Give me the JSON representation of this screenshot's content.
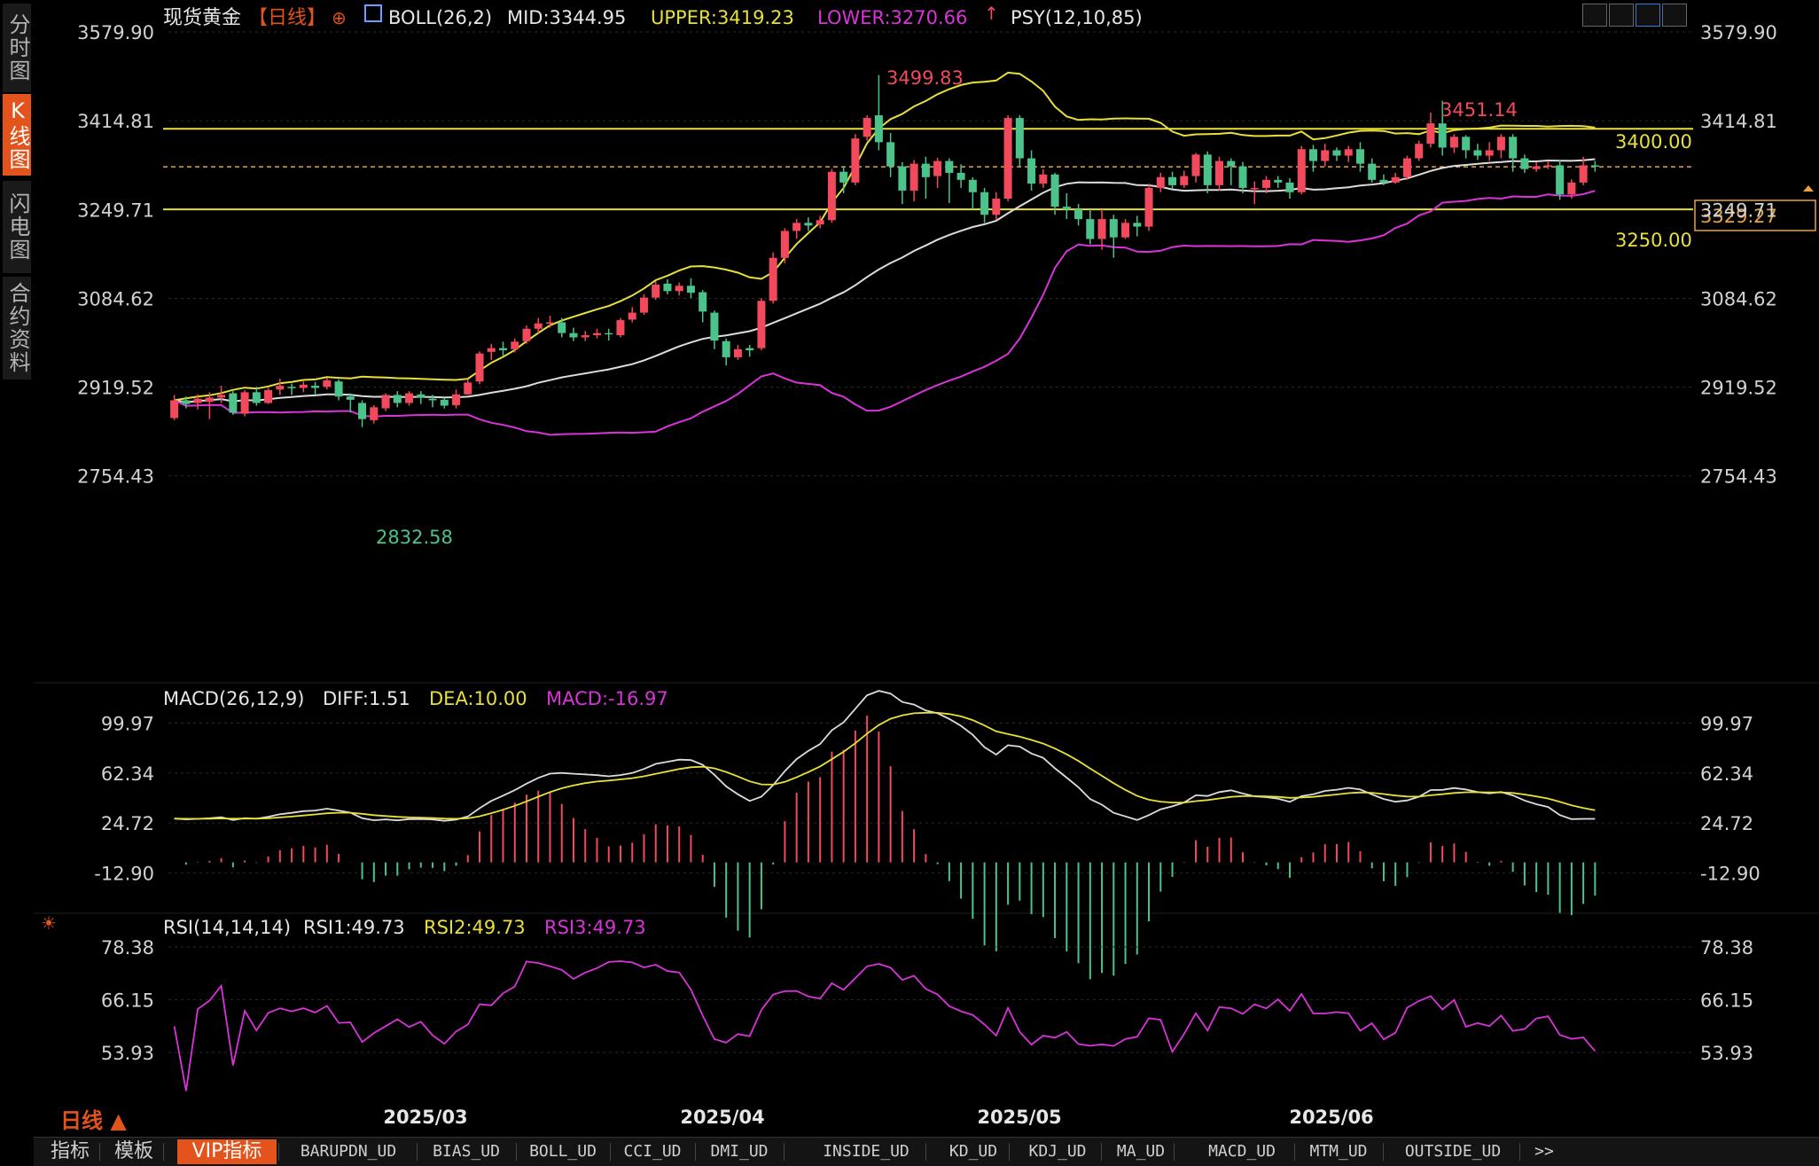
{
  "side_tabs": [
    {
      "label": "分时图",
      "active": false
    },
    {
      "label": "K线图",
      "active": true
    },
    {
      "label": "闪电图",
      "active": false
    },
    {
      "label": "合约资料",
      "active": false
    }
  ],
  "header": {
    "title": "现货黄金",
    "period": "【日线】",
    "boll_label": "BOLL(26,2)",
    "mid": "MID:3344.95",
    "upper": "UPPER:3419.23",
    "lower": "LOWER:3270.66",
    "psy": "PSY(12,10,85)"
  },
  "colors": {
    "up": "#f2495c",
    "down": "#4cc38a",
    "mid": "#dcdcdc",
    "upper": "#e8e03a",
    "lower": "#d933d9",
    "hline": "#e8e03a",
    "dashed": "#e8a23a",
    "accent": "#e2541b"
  },
  "price_axis": {
    "ticks": [
      "3579.90",
      "3414.81",
      "3249.71",
      "3084.62",
      "2919.52",
      "2754.43"
    ],
    "current_price": "3329.27"
  },
  "annotations": {
    "high1": "3499.83",
    "high2": "3451.14",
    "low1": "2832.58",
    "hline_upper": "3400.00",
    "hline_lower": "3250.00"
  },
  "macd": {
    "label": "MACD(26,12,9)",
    "diff": "DIFF:1.51",
    "dea": "DEA:10.00",
    "macd": "MACD:-16.97",
    "ticks": [
      "99.97",
      "62.34",
      "24.72",
      "-12.90"
    ]
  },
  "rsi": {
    "label": "RSI(14,14,14)",
    "rsi1": "RSI1:49.73",
    "rsi2": "RSI2:49.73",
    "rsi3": "RSI3:49.73",
    "ticks": [
      "78.38",
      "66.15",
      "53.93"
    ]
  },
  "x_axis": {
    "labels": [
      "2025/03",
      "2025/04",
      "2025/05",
      "2025/06"
    ],
    "period_button": "日线 ▲"
  },
  "bottom_tabs": [
    {
      "label": "指标",
      "active": false
    },
    {
      "label": "模板",
      "active": false
    },
    {
      "label": "VIP指标",
      "active": true
    },
    {
      "label": "BARUPDN_UD",
      "active": false
    },
    {
      "label": "BIAS_UD",
      "active": false
    },
    {
      "label": "BOLL_UD",
      "active": false
    },
    {
      "label": "CCI_UD",
      "active": false
    },
    {
      "label": "DMI_UD",
      "active": false
    },
    {
      "label": "INSIDE_UD",
      "active": false
    },
    {
      "label": "KD_UD",
      "active": false
    },
    {
      "label": "KDJ_UD",
      "active": false
    },
    {
      "label": "MA_UD",
      "active": false
    },
    {
      "label": "MACD_UD",
      "active": false
    },
    {
      "label": "MTM_UD",
      "active": false
    },
    {
      "label": "OUTSIDE_UD",
      "active": false
    },
    {
      "label": ">>",
      "active": false
    }
  ],
  "chart_data": {
    "type": "candlestick",
    "title": "现货黄金",
    "ylim": [
      2650,
      3590
    ],
    "candles": [
      [
        2862,
        2895,
        2858,
        2905
      ],
      [
        2895,
        2888,
        2880,
        2902
      ],
      [
        2890,
        2898,
        2878,
        2906
      ],
      [
        2892,
        2900,
        2860,
        2910
      ],
      [
        2900,
        2905,
        2890,
        2922
      ],
      [
        2908,
        2872,
        2868,
        2912
      ],
      [
        2870,
        2910,
        2865,
        2914
      ],
      [
        2910,
        2890,
        2885,
        2920
      ],
      [
        2890,
        2914,
        2888,
        2918
      ],
      [
        2915,
        2922,
        2905,
        2935
      ],
      [
        2920,
        2918,
        2905,
        2926
      ],
      [
        2918,
        2924,
        2910,
        2930
      ],
      [
        2922,
        2918,
        2905,
        2929
      ],
      [
        2920,
        2932,
        2915,
        2936
      ],
      [
        2930,
        2902,
        2895,
        2934
      ],
      [
        2902,
        2896,
        2872,
        2908
      ],
      [
        2890,
        2860,
        2845,
        2895
      ],
      [
        2858,
        2882,
        2852,
        2886
      ],
      [
        2880,
        2905,
        2875,
        2908
      ],
      [
        2905,
        2890,
        2882,
        2912
      ],
      [
        2890,
        2908,
        2885,
        2912
      ],
      [
        2906,
        2900,
        2888,
        2912
      ],
      [
        2898,
        2895,
        2882,
        2905
      ],
      [
        2896,
        2885,
        2880,
        2900
      ],
      [
        2886,
        2906,
        2880,
        2915
      ],
      [
        2906,
        2928,
        2905,
        2934
      ],
      [
        2930,
        2982,
        2925,
        2986
      ],
      [
        2985,
        2992,
        2970,
        3000
      ],
      [
        2992,
        2988,
        2978,
        3004
      ],
      [
        2990,
        3004,
        2984,
        3010
      ],
      [
        3005,
        3028,
        3000,
        3034
      ],
      [
        3028,
        3038,
        3020,
        3048
      ],
      [
        3038,
        3040,
        3030,
        3052
      ],
      [
        3040,
        3020,
        3012,
        3048
      ],
      [
        3020,
        3012,
        3005,
        3030
      ],
      [
        3012,
        3016,
        3005,
        3024
      ],
      [
        3016,
        3020,
        3010,
        3028
      ],
      [
        3020,
        3018,
        3006,
        3028
      ],
      [
        3016,
        3044,
        3012,
        3048
      ],
      [
        3045,
        3058,
        3040,
        3068
      ],
      [
        3058,
        3086,
        3054,
        3092
      ],
      [
        3086,
        3110,
        3082,
        3116
      ],
      [
        3112,
        3098,
        3092,
        3120
      ],
      [
        3098,
        3108,
        3090,
        3114
      ],
      [
        3108,
        3095,
        3085,
        3122
      ],
      [
        3096,
        3060,
        3040,
        3100
      ],
      [
        3058,
        3006,
        2990,
        3062
      ],
      [
        3005,
        2975,
        2960,
        3010
      ],
      [
        2975,
        2990,
        2970,
        2998
      ],
      [
        2992,
        2988,
        2976,
        2998
      ],
      [
        2992,
        3080,
        2988,
        3085
      ],
      [
        3080,
        3160,
        3075,
        3170
      ],
      [
        3160,
        3210,
        3150,
        3215
      ],
      [
        3210,
        3225,
        3195,
        3232
      ],
      [
        3225,
        3220,
        3210,
        3235
      ],
      [
        3222,
        3230,
        3215,
        3238
      ],
      [
        3230,
        3320,
        3225,
        3325
      ],
      [
        3320,
        3300,
        3280,
        3330
      ],
      [
        3300,
        3382,
        3295,
        3390
      ],
      [
        3385,
        3420,
        3378,
        3425
      ],
      [
        3425,
        3375,
        3360,
        3500
      ],
      [
        3375,
        3330,
        3310,
        3392
      ],
      [
        3330,
        3285,
        3260,
        3338
      ],
      [
        3285,
        3335,
        3265,
        3342
      ],
      [
        3335,
        3310,
        3270,
        3348
      ],
      [
        3312,
        3340,
        3290,
        3346
      ],
      [
        3340,
        3318,
        3262,
        3345
      ],
      [
        3318,
        3305,
        3290,
        3334
      ],
      [
        3305,
        3282,
        3250,
        3310
      ],
      [
        3282,
        3240,
        3225,
        3290
      ],
      [
        3240,
        3270,
        3230,
        3282
      ],
      [
        3270,
        3420,
        3265,
        3425
      ],
      [
        3420,
        3345,
        3330,
        3425
      ],
      [
        3345,
        3298,
        3285,
        3360
      ],
      [
        3298,
        3315,
        3290,
        3325
      ],
      [
        3315,
        3255,
        3240,
        3318
      ],
      [
        3255,
        3250,
        3232,
        3280
      ],
      [
        3250,
        3232,
        3220,
        3260
      ],
      [
        3232,
        3195,
        3185,
        3250
      ],
      [
        3195,
        3232,
        3175,
        3250
      ],
      [
        3232,
        3198,
        3160,
        3240
      ],
      [
        3198,
        3225,
        3195,
        3232
      ],
      [
        3225,
        3218,
        3200,
        3238
      ],
      [
        3218,
        3290,
        3210,
        3298
      ],
      [
        3290,
        3310,
        3282,
        3318
      ],
      [
        3310,
        3295,
        3288,
        3320
      ],
      [
        3295,
        3312,
        3290,
        3322
      ],
      [
        3312,
        3352,
        3300,
        3355
      ],
      [
        3352,
        3295,
        3280,
        3358
      ],
      [
        3295,
        3340,
        3285,
        3348
      ],
      [
        3340,
        3330,
        3295,
        3345
      ],
      [
        3330,
        3290,
        3280,
        3338
      ],
      [
        3290,
        3290,
        3260,
        3302
      ],
      [
        3290,
        3305,
        3280,
        3312
      ],
      [
        3305,
        3300,
        3290,
        3312
      ],
      [
        3300,
        3282,
        3270,
        3308
      ],
      [
        3282,
        3362,
        3278,
        3368
      ],
      [
        3362,
        3340,
        3320,
        3370
      ],
      [
        3340,
        3360,
        3330,
        3372
      ],
      [
        3360,
        3350,
        3340,
        3365
      ],
      [
        3350,
        3362,
        3338,
        3368
      ],
      [
        3362,
        3335,
        3320,
        3375
      ],
      [
        3335,
        3305,
        3300,
        3345
      ],
      [
        3305,
        3300,
        3295,
        3315
      ],
      [
        3300,
        3310,
        3298,
        3318
      ],
      [
        3310,
        3345,
        3305,
        3350
      ],
      [
        3345,
        3372,
        3340,
        3378
      ],
      [
        3372,
        3410,
        3365,
        3430
      ],
      [
        3410,
        3365,
        3350,
        3452
      ],
      [
        3365,
        3385,
        3355,
        3390
      ],
      [
        3385,
        3360,
        3345,
        3388
      ],
      [
        3360,
        3350,
        3342,
        3372
      ],
      [
        3350,
        3360,
        3340,
        3375
      ],
      [
        3360,
        3385,
        3345,
        3390
      ],
      [
        3385,
        3345,
        3320,
        3390
      ],
      [
        3345,
        3325,
        3318,
        3352
      ],
      [
        3325,
        3330,
        3320,
        3338
      ],
      [
        3330,
        3332,
        3325,
        3340
      ],
      [
        3332,
        3278,
        3268,
        3342
      ],
      [
        3278,
        3300,
        3270,
        3306
      ],
      [
        3300,
        3332,
        3295,
        3348
      ],
      [
        3332,
        3330,
        3320,
        3340
      ]
    ],
    "series": [
      {
        "name": "MID"
      },
      {
        "name": "UPPER"
      },
      {
        "name": "LOWER"
      }
    ]
  }
}
